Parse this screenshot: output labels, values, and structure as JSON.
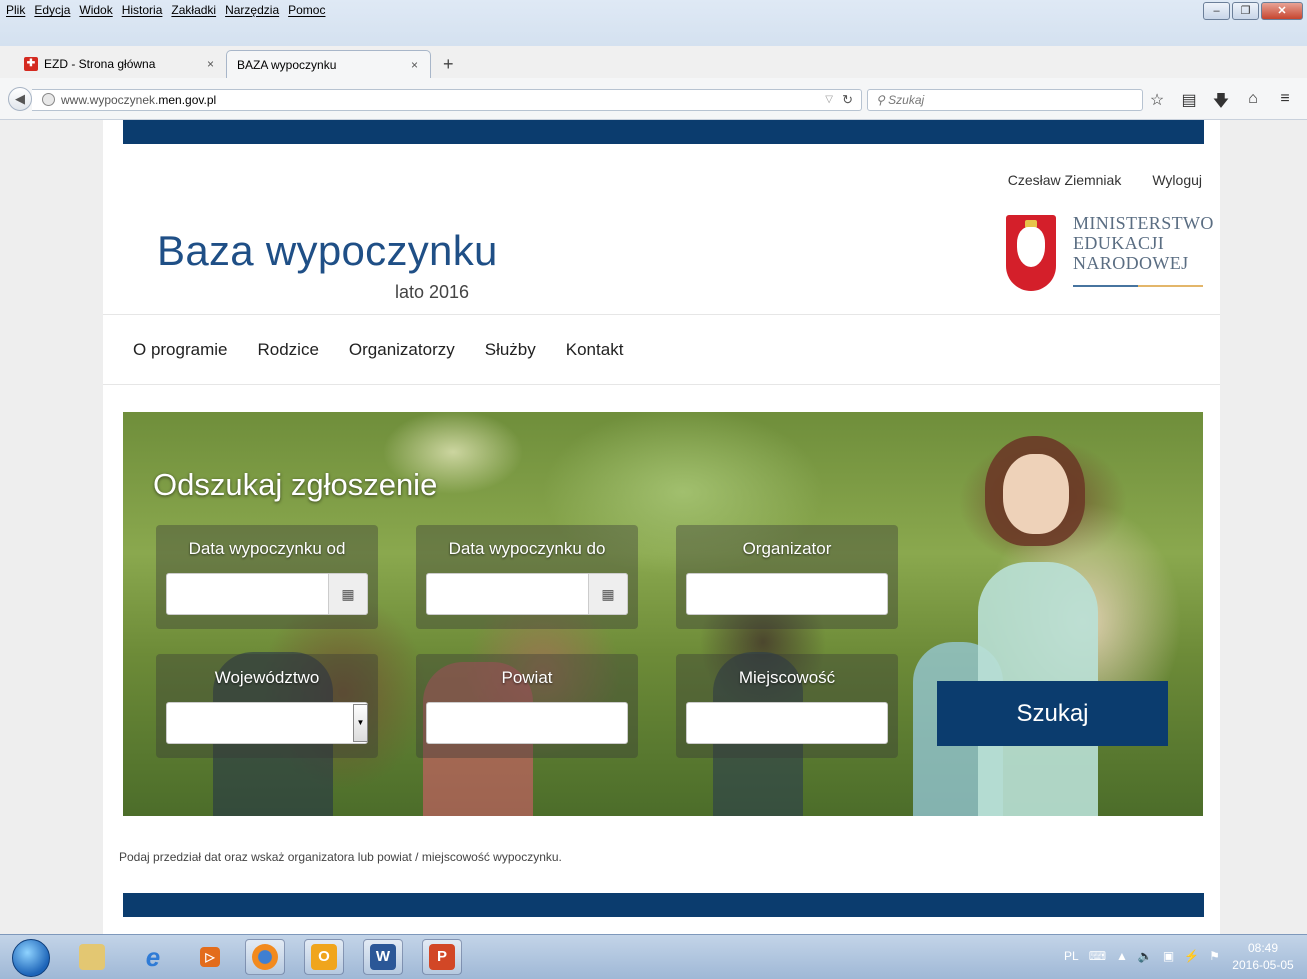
{
  "browser": {
    "menu": [
      "Plik",
      "Edycja",
      "Widok",
      "Historia",
      "Zakładki",
      "Narzędzia",
      "Pomoc"
    ],
    "tabs": [
      {
        "label": "EZD - Strona główna",
        "active": false
      },
      {
        "label": "BAZA wypoczynku",
        "active": true
      }
    ],
    "url_prefix": "www.wypoczynek.",
    "url_host": "men.gov.pl",
    "search_placeholder": "Szukaj"
  },
  "site": {
    "user_name": "Czesław Ziemniak",
    "logout": "Wyloguj",
    "title": "Baza wypoczynku",
    "subtitle": "lato 2016",
    "ministry_line1": "MINISTERSTWO",
    "ministry_line2": "EDUKACJI",
    "ministry_line3": "NARODOWEJ",
    "nav": [
      "O programie",
      "Rodzice",
      "Organizatorzy",
      "Służby",
      "Kontakt"
    ],
    "colors": {
      "brand": "#0b3c6e",
      "title": "#1f4f86"
    }
  },
  "search": {
    "heading": "Odszukaj zgłoszenie",
    "fields": {
      "date_from": {
        "label": "Data wypoczynku od",
        "value": ""
      },
      "date_to": {
        "label": "Data wypoczynku do",
        "value": ""
      },
      "organizer": {
        "label": "Organizator",
        "value": ""
      },
      "voivodeship": {
        "label": "Województwo",
        "value": ""
      },
      "district": {
        "label": "Powiat",
        "value": ""
      },
      "locality": {
        "label": "Miejscowość",
        "value": ""
      }
    },
    "button": "Szukaj",
    "hint": "Podaj przedział dat oraz wskaż organizatora lub powiat / miejscowość wypoczynku."
  },
  "taskbar": {
    "apps": [
      "file-explorer",
      "internet-explorer",
      "outlook-small",
      "firefox",
      "outlook",
      "word",
      "powerpoint"
    ],
    "tray_lang": "PL",
    "time": "08:49",
    "date": "2016-05-05"
  }
}
